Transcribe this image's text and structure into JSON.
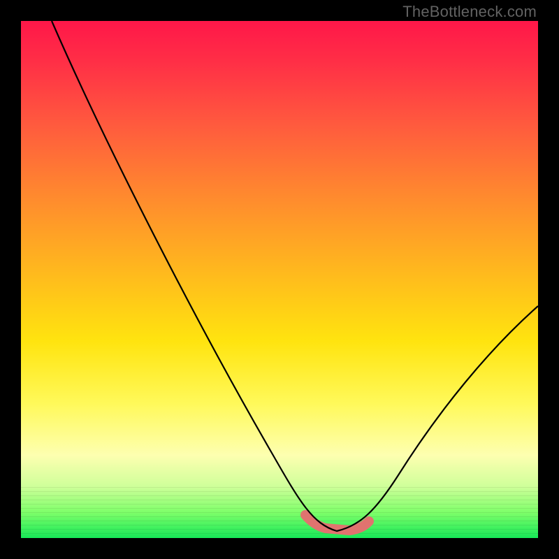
{
  "watermark": "TheBottleneck.com",
  "chart_data": {
    "type": "line",
    "title": "",
    "xlabel": "",
    "ylabel": "",
    "xlim": [
      0,
      100
    ],
    "ylim": [
      0,
      100
    ],
    "grid": false,
    "series": [
      {
        "name": "bottleneck-curve",
        "color": "#000000",
        "x": [
          6,
          12,
          18,
          24,
          30,
          36,
          42,
          48,
          52,
          55,
          58,
          61,
          64,
          67,
          72,
          78,
          85,
          92,
          100
        ],
        "y": [
          100,
          88,
          76,
          64,
          52,
          40,
          29,
          17,
          10,
          5,
          2,
          1,
          1,
          2,
          6,
          13,
          22,
          33,
          45
        ]
      },
      {
        "name": "optimal-range-highlight",
        "color": "#e0736f",
        "x": [
          55,
          58,
          61,
          64,
          67
        ],
        "y": [
          4.5,
          2.5,
          1.5,
          1.5,
          3.0
        ]
      }
    ],
    "annotations": [],
    "background_gradient": {
      "top": "#ff1749",
      "bottom": "#17e858",
      "meaning": "red = high bottleneck, green = balanced"
    }
  }
}
